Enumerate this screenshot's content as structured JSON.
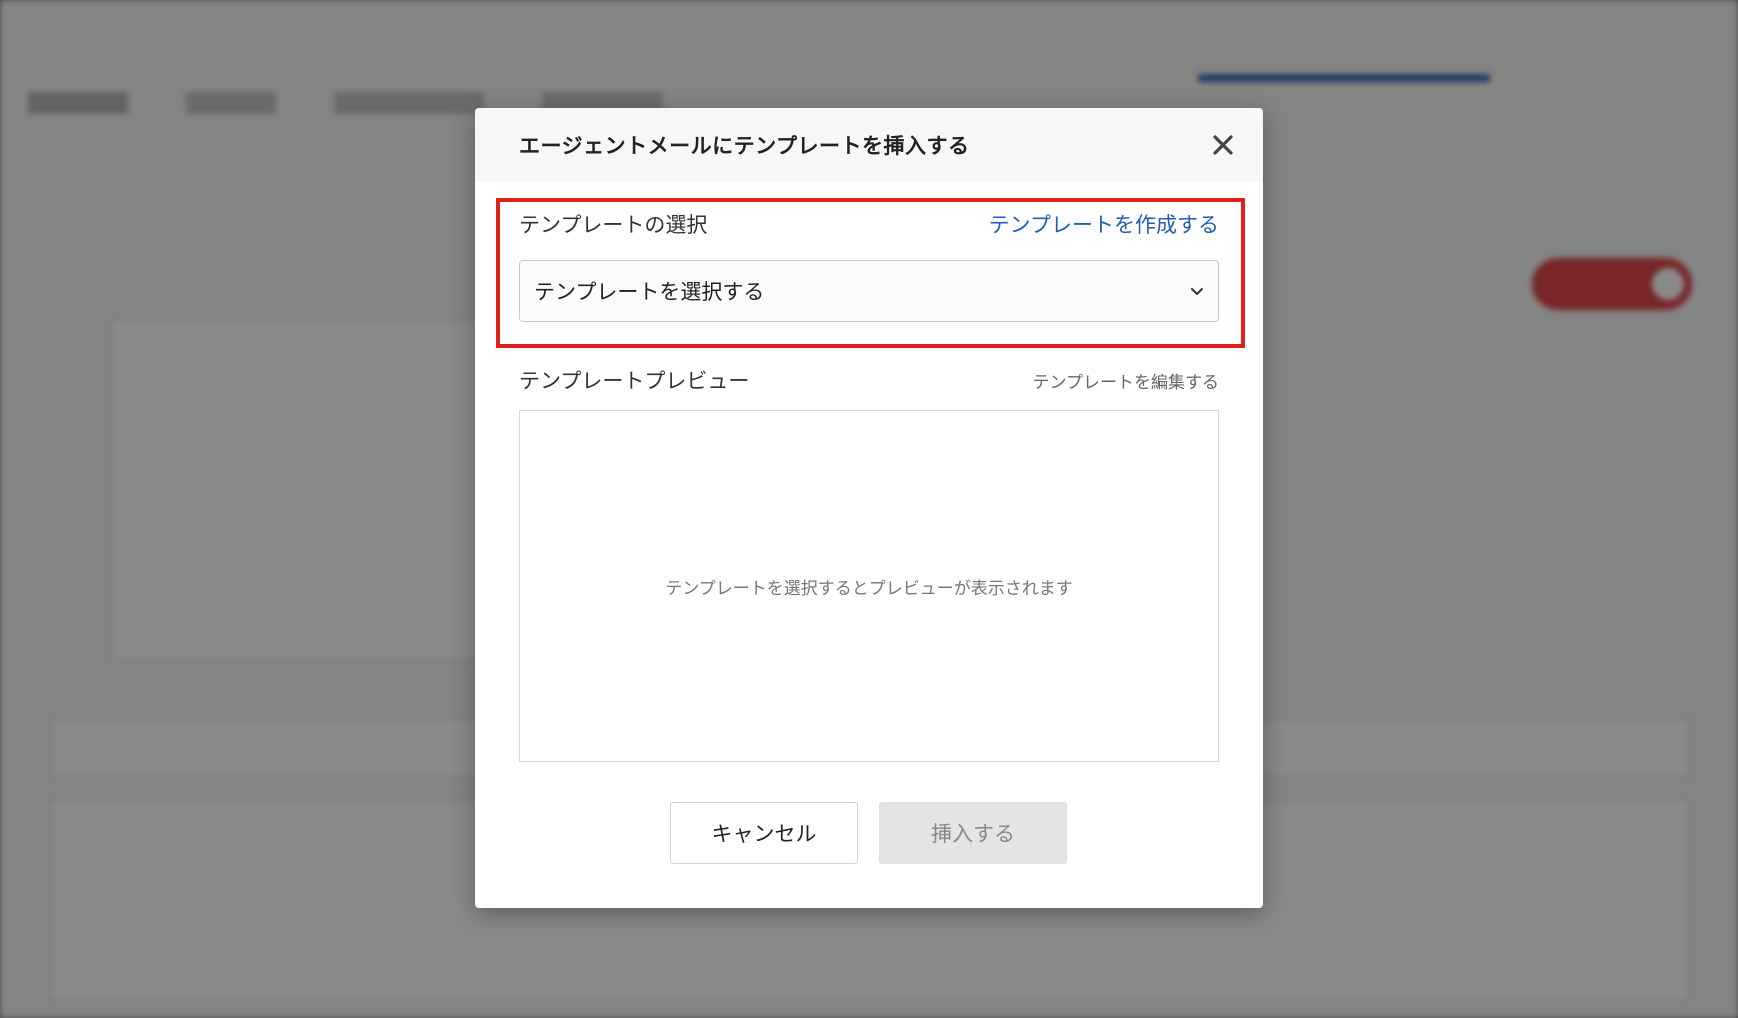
{
  "modal": {
    "title": "エージェントメールにテンプレートを挿入する",
    "close_icon": "close-icon",
    "template_select": {
      "label": "テンプレートの選択",
      "create_link": "テンプレートを作成する",
      "selected_value": "テンプレートを選択する",
      "dropdown_icon": "chevron-down-icon"
    },
    "preview": {
      "label": "テンプレートプレビュー",
      "edit_link": "テンプレートを編集する",
      "placeholder": "テンプレートを選択するとプレビューが表示されます"
    },
    "buttons": {
      "cancel": "キャンセル",
      "insert": "挿入する"
    }
  },
  "colors": {
    "highlight": "#e0201b",
    "link": "#1f5fb5",
    "disabled_button": "#e4e4e4"
  }
}
